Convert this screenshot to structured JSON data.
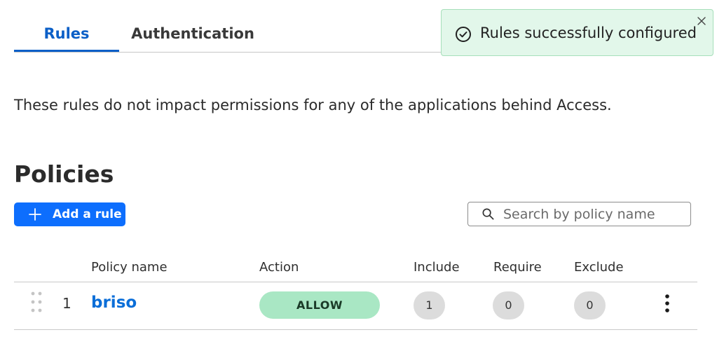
{
  "tabs": [
    {
      "label": "Rules",
      "active": true
    },
    {
      "label": "Authentication",
      "active": false
    }
  ],
  "toast": {
    "message": "Rules successfully configured",
    "icon": "check-circle-icon",
    "close_icon": "close-icon"
  },
  "description": "These rules do not impact permissions for any of the applications behind Access.",
  "policies": {
    "title": "Policies",
    "add_button_label": "Add a rule",
    "search_placeholder": "Search by policy name",
    "search_value": ""
  },
  "table": {
    "columns": [
      "Policy name",
      "Action",
      "Include",
      "Require",
      "Exclude"
    ],
    "rows": [
      {
        "index": "1",
        "name": "briso",
        "action": "ALLOW",
        "include": "1",
        "require": "0",
        "exclude": "0"
      }
    ]
  },
  "colors": {
    "accent": "#0b5fc7",
    "button": "#0d6efd",
    "toast_bg": "#e2f7ea",
    "allow_badge": "#a9e7c4",
    "count_badge": "#dcdcdc"
  }
}
